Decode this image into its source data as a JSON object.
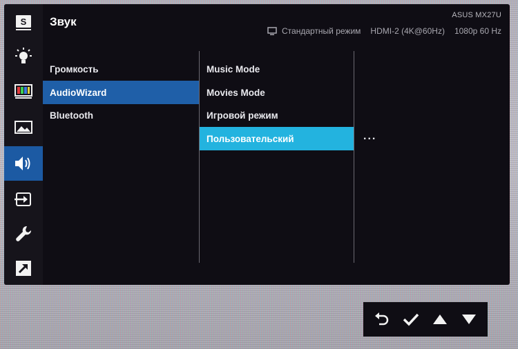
{
  "header": {
    "title": "Звук",
    "brand": "ASUS MX27U",
    "mode": "Стандартный режим",
    "input": "HDMI-2 (4K@60Hz)",
    "resolution": "1080p 60 Hz"
  },
  "sidebar": {
    "items": [
      {
        "icon": "splendid-s-icon"
      },
      {
        "icon": "brightness-icon"
      },
      {
        "icon": "color-bars-icon"
      },
      {
        "icon": "image-icon"
      },
      {
        "icon": "speaker-icon",
        "active": true
      },
      {
        "icon": "input-select-icon"
      },
      {
        "icon": "wrench-icon"
      },
      {
        "icon": "shortcut-arrow-icon"
      }
    ]
  },
  "menu": {
    "column1": [
      "Громкость",
      "AudioWizard",
      "Bluetooth"
    ],
    "column1_selected": "AudioWizard",
    "column2": [
      "Music Mode",
      "Movies Mode",
      "Игровой режим",
      "Пользовательский"
    ],
    "column2_selected": "Пользовательский",
    "column3_more": "..."
  },
  "colors": {
    "osd_bg": "#0f0d14",
    "active_blue": "#1f5fa8",
    "highlight_cyan": "#23b3df"
  },
  "nav": [
    "back-icon",
    "confirm-icon",
    "up-icon",
    "down-icon"
  ]
}
